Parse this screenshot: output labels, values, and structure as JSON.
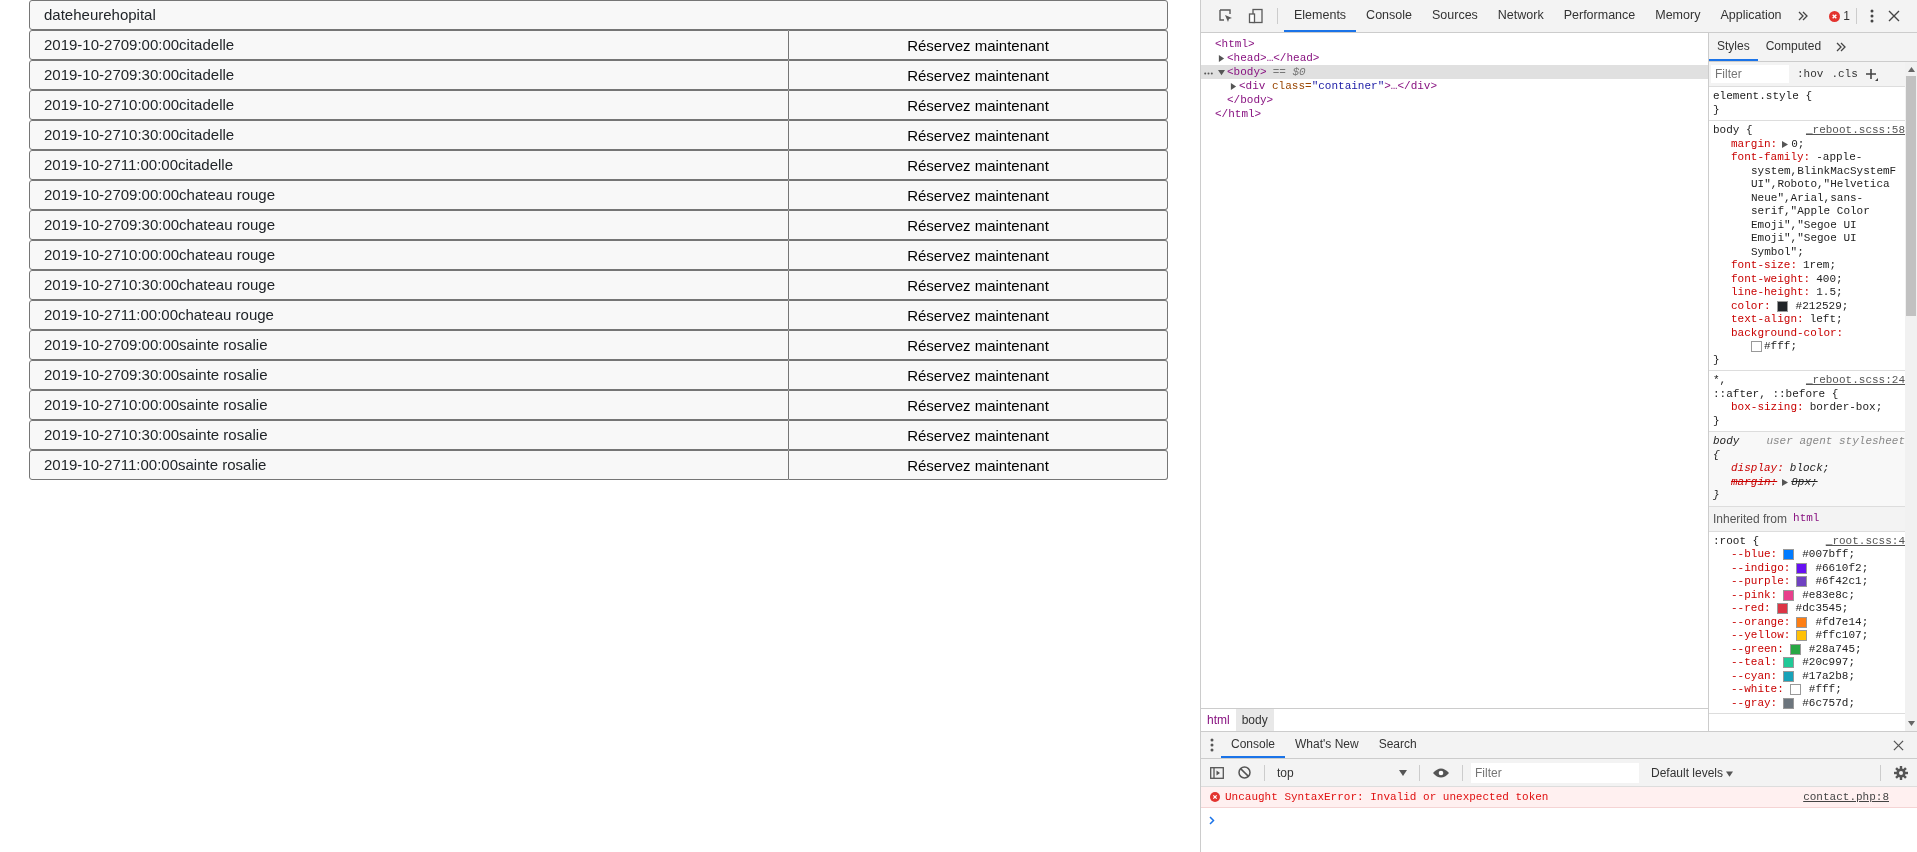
{
  "page": {
    "header": "dateheurehopital",
    "rows": [
      {
        "text": "2019-10-2709:00:00citadelle",
        "button": "Réservez maintenant"
      },
      {
        "text": "2019-10-2709:30:00citadelle",
        "button": "Réservez maintenant"
      },
      {
        "text": "2019-10-2710:00:00citadelle",
        "button": "Réservez maintenant"
      },
      {
        "text": "2019-10-2710:30:00citadelle",
        "button": "Réservez maintenant"
      },
      {
        "text": "2019-10-2711:00:00citadelle",
        "button": "Réservez maintenant"
      },
      {
        "text": "2019-10-2709:00:00chateau rouge",
        "button": "Réservez maintenant"
      },
      {
        "text": "2019-10-2709:30:00chateau rouge",
        "button": "Réservez maintenant"
      },
      {
        "text": "2019-10-2710:00:00chateau rouge",
        "button": "Réservez maintenant"
      },
      {
        "text": "2019-10-2710:30:00chateau rouge",
        "button": "Réservez maintenant"
      },
      {
        "text": "2019-10-2711:00:00chateau rouge",
        "button": "Réservez maintenant"
      },
      {
        "text": "2019-10-2709:00:00sainte rosalie",
        "button": "Réservez maintenant"
      },
      {
        "text": "2019-10-2709:30:00sainte rosalie",
        "button": "Réservez maintenant"
      },
      {
        "text": "2019-10-2710:00:00sainte rosalie",
        "button": "Réservez maintenant"
      },
      {
        "text": "2019-10-2710:30:00sainte rosalie",
        "button": "Réservez maintenant"
      },
      {
        "text": "2019-10-2711:00:00sainte rosalie",
        "button": "Réservez maintenant"
      }
    ]
  },
  "devtools": {
    "tabs": [
      {
        "label": "Elements",
        "selected": true
      },
      {
        "label": "Console",
        "selected": false
      },
      {
        "label": "Sources",
        "selected": false
      },
      {
        "label": "Network",
        "selected": false
      },
      {
        "label": "Performance",
        "selected": false
      },
      {
        "label": "Memory",
        "selected": false
      },
      {
        "label": "Application",
        "selected": false
      }
    ],
    "error_count": "1",
    "dom": [
      {
        "tag": "<html",
        "end": ">",
        "close": "</html>",
        "selected": false,
        "children": [
          {
            "tag": "<head",
            "end": ">",
            "close": "…</head>",
            "expanded": false,
            "selected": false
          },
          {
            "tag": "<body",
            "end": ">",
            "suffix": "== $0",
            "close": "</body>",
            "expanded": true,
            "selected": true,
            "children": [
              {
                "tag": "<div",
                "attributes": [
                  {
                    "name": "class=",
                    "value": "\"container\""
                  }
                ],
                "end": ">",
                "close": "…</div>",
                "expanded": false,
                "selected": false
              }
            ]
          }
        ]
      }
    ],
    "styles": {
      "tabs": [
        {
          "label": "Styles",
          "selected": true
        },
        {
          "label": "Computed",
          "selected": false
        }
      ],
      "filter": {
        "placeholder": "Filter"
      },
      "hov": ":hov",
      "cls": ".cls",
      "rules": [
        {
          "kind": "author",
          "selector": "element.style {",
          "close": "}"
        },
        {
          "kind": "author",
          "selector": "body {",
          "source": "_reboot.scss:58",
          "close": "}",
          "declarations": [
            {
              "prop": "margin:",
              "value": "0;",
              "arrow": true
            },
            {
              "prop": "font-family:",
              "value": "-apple-",
              "wrap": [
                "system,BlinkMacSystemF",
                "UI\",Roboto,\"Helvetica",
                "Neue\",Arial,sans-",
                "serif,\"Apple Color",
                "Emoji\",\"Segoe UI",
                "Emoji\",\"Segoe UI",
                "Symbol\";"
              ]
            },
            {
              "prop": "font-size:",
              "value": "1rem;"
            },
            {
              "prop": "font-weight:",
              "value": "400;"
            },
            {
              "prop": "line-height:",
              "value": "1.5;"
            },
            {
              "prop": "color:",
              "value": "#212529",
              "end": ";",
              "swatch": true
            },
            {
              "prop": "text-align:",
              "value": "left;"
            },
            {
              "prop": "background-color:",
              "value": "#fff",
              "end": ";",
              "swatch": true,
              "break": true
            }
          ]
        },
        {
          "kind": "author",
          "selector": "*,",
          "selector_2": "::after, ::before {",
          "source": "_reboot.scss:24",
          "close": "}",
          "declarations": [
            {
              "prop": "box-sizing:",
              "value": "border-box;"
            }
          ]
        },
        {
          "kind": "user-agent",
          "selector": "body",
          "source": "user agent stylesheet",
          "open": "{",
          "close": "}",
          "declarations": [
            {
              "prop": "display:",
              "value": "block;"
            },
            {
              "prop": "margin:",
              "value": "8px;",
              "arrow": true,
              "struck": true
            }
          ]
        },
        {
          "kind": "inherited",
          "label": "Inherited from",
          "tag": "html"
        },
        {
          "kind": "author",
          "selector": ":root {",
          "source": "_root.scss:4",
          "declarations": [
            {
              "prop": "--blue:",
              "value": "#007bff",
              "end": ";",
              "swatch": true
            },
            {
              "prop": "--indigo:",
              "value": "#6610f2",
              "end": ";",
              "swatch": true
            },
            {
              "prop": "--purple:",
              "value": "#6f42c1",
              "end": ";",
              "swatch": true
            },
            {
              "prop": "--pink:",
              "value": "#e83e8c",
              "end": ";",
              "swatch": true
            },
            {
              "prop": "--red:",
              "value": "#dc3545",
              "end": ";",
              "swatch": true
            },
            {
              "prop": "--orange:",
              "value": "#fd7e14",
              "end": ";",
              "swatch": true
            },
            {
              "prop": "--yellow:",
              "value": "#ffc107",
              "end": ";",
              "swatch": true
            },
            {
              "prop": "--green:",
              "value": "#28a745",
              "end": ";",
              "swatch": true
            },
            {
              "prop": "--teal:",
              "value": "#20c997",
              "end": ";",
              "swatch": true
            },
            {
              "prop": "--cyan:",
              "value": "#17a2b8",
              "end": ";",
              "swatch": true
            },
            {
              "prop": "--white:",
              "value": "#fff",
              "end": ";",
              "swatch": true
            },
            {
              "prop": "--gray:",
              "value": "#6c757d",
              "end": ";",
              "swatch": true
            }
          ]
        }
      ]
    },
    "breadcrumbs": [
      {
        "label": "html",
        "selected": false
      },
      {
        "label": "body",
        "selected": true
      }
    ],
    "drawer": {
      "tabs": [
        {
          "label": "Console",
          "selected": true
        },
        {
          "label": "What's New",
          "selected": false
        },
        {
          "label": "Search",
          "selected": false
        }
      ],
      "context": "top",
      "filter": {
        "placeholder": "Filter"
      },
      "levels": "Default levels",
      "messages": [
        {
          "kind": "error",
          "text": "Uncaught SyntaxError: Invalid or unexpected token",
          "source": "contact.php:8"
        }
      ]
    }
  }
}
